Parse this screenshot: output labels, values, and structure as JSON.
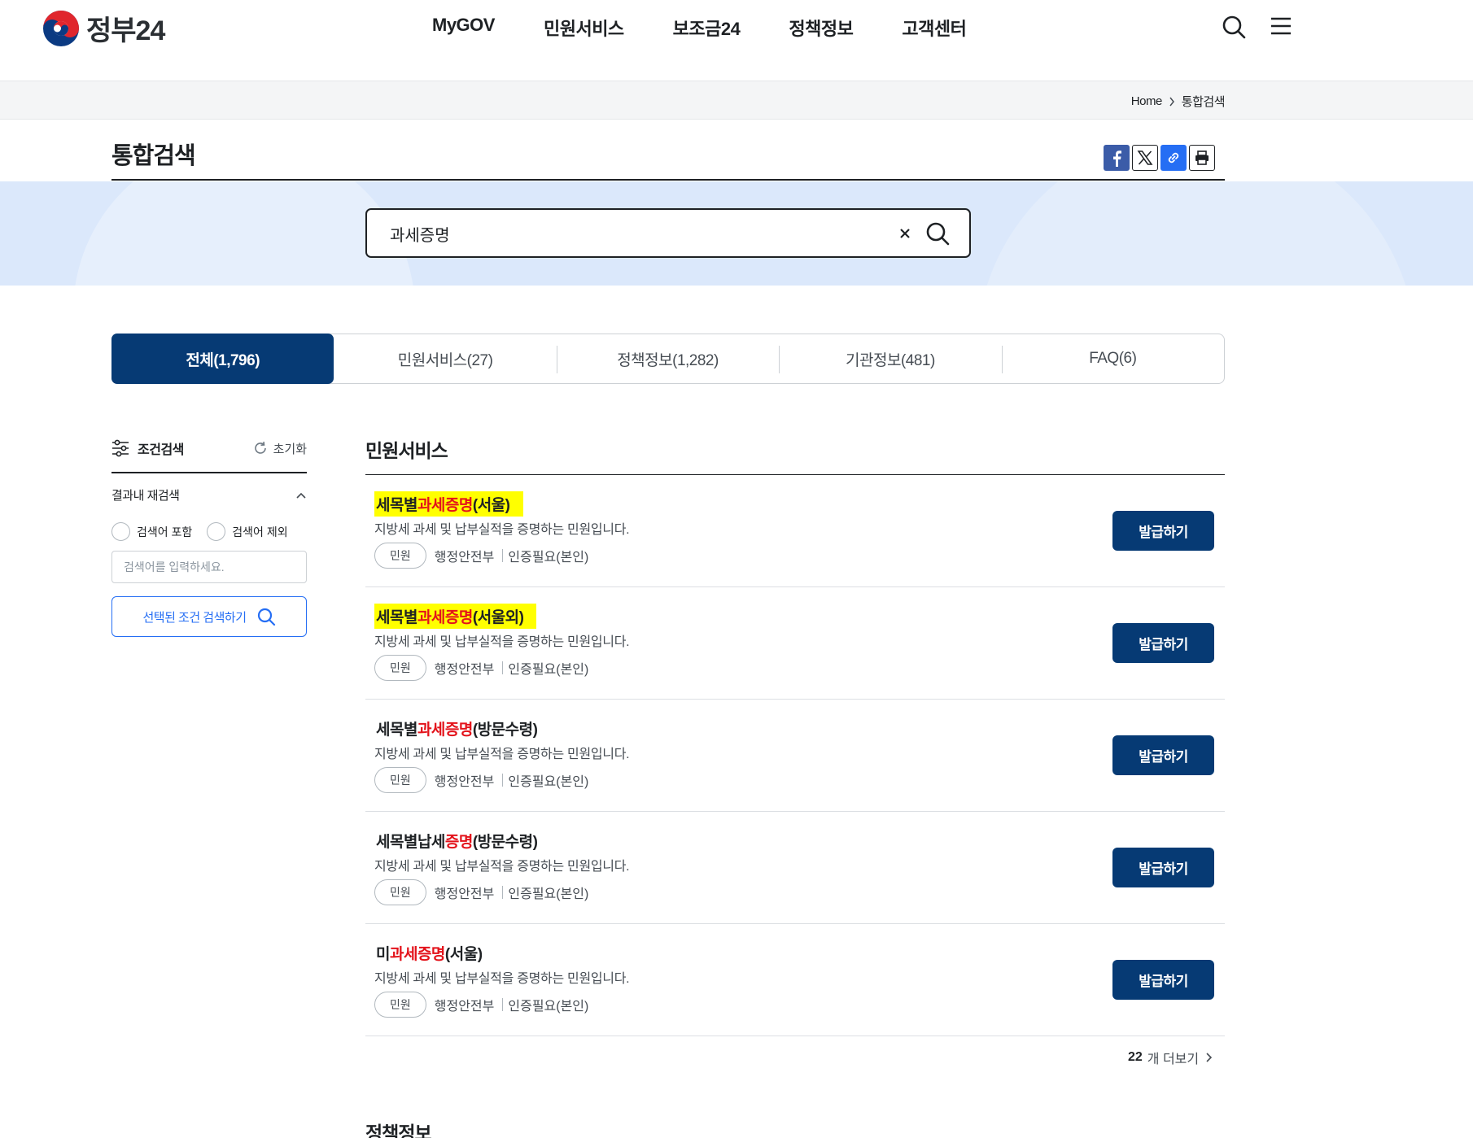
{
  "header": {
    "logo_text": "정부24",
    "nav": [
      "MyGOV",
      "민원서비스",
      "보조금24",
      "정책정보",
      "고객센터"
    ]
  },
  "breadcrumb": {
    "home": "Home",
    "current": "통합검색"
  },
  "page": {
    "title": "통합검색"
  },
  "search": {
    "value": "과세증명"
  },
  "tabs": [
    {
      "label": "전체(1,796)",
      "active": true
    },
    {
      "label": "민원서비스(27)",
      "active": false
    },
    {
      "label": "정책정보(1,282)",
      "active": false
    },
    {
      "label": "기관정보(481)",
      "active": false
    },
    {
      "label": "FAQ(6)",
      "active": false
    }
  ],
  "filter": {
    "title": "조건검색",
    "reset": "초기화",
    "sub_title": "결과내 재검색",
    "include": "검색어 포함",
    "exclude": "검색어 제외",
    "placeholder": "검색어를 입력하세요.",
    "submit": "선택된 조건 검색하기"
  },
  "results_section": {
    "title": "민원서비스",
    "items": [
      {
        "pre": "세목별",
        "kw": "과세증명",
        "post": "(서울)",
        "highlight": true,
        "desc": "지방세 과세 및 납부실적을 증명하는 민원입니다.",
        "badge": "민원",
        "org": "행정안전부",
        "auth": "인증필요(본인)",
        "button": "발급하기"
      },
      {
        "pre": "세목별",
        "kw": "과세증명",
        "post": "(서울외)",
        "highlight": true,
        "desc": "지방세 과세 및 납부실적을 증명하는 민원입니다.",
        "badge": "민원",
        "org": "행정안전부",
        "auth": "인증필요(본인)",
        "button": "발급하기"
      },
      {
        "pre": "세목별",
        "kw": "과세증명",
        "post": "(방문수령)",
        "highlight": false,
        "desc": "지방세 과세 및 납부실적을 증명하는 민원입니다.",
        "badge": "민원",
        "org": "행정안전부",
        "auth": "인증필요(본인)",
        "button": "발급하기"
      },
      {
        "pre": "세목별납세",
        "kw": "증명",
        "post": "(방문수령)",
        "highlight": false,
        "desc": "지방세 과세 및 납부실적을 증명하는 민원입니다.",
        "badge": "민원",
        "org": "행정안전부",
        "auth": "인증필요(본인)",
        "button": "발급하기"
      },
      {
        "pre": "미",
        "kw": "과세증명",
        "post": "(서울)",
        "highlight": false,
        "desc": "지방세 과세 및 납부실적을 증명하는 민원입니다.",
        "badge": "민원",
        "org": "행정안전부",
        "auth": "인증필요(본인)",
        "button": "발급하기"
      }
    ],
    "more_count": "22",
    "more_label": "개 더보기"
  },
  "next_section": {
    "title": "정책정보"
  },
  "colors": {
    "primary": "#063a74",
    "accent": "#256ef4",
    "keyword": "#e3131b",
    "highlight": "#ffff00",
    "banner": "#dbe8fb"
  }
}
